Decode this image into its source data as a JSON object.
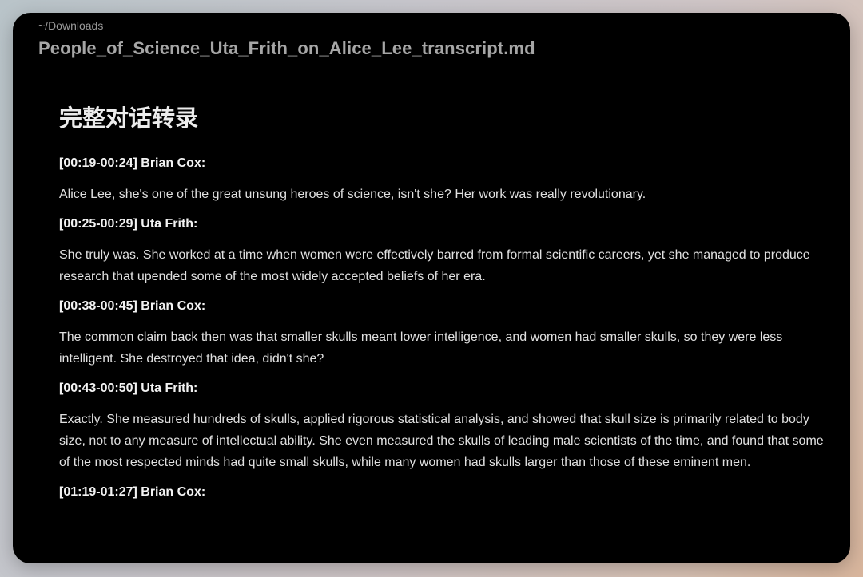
{
  "window": {
    "path": "~/Downloads",
    "filename": "People_of_Science_Uta_Frith_on_Alice_Lee_transcript.md"
  },
  "document": {
    "heading": "完整对话转录",
    "entries": [
      {
        "speaker": "[00:19-00:24] Brian Cox:",
        "text": "Alice Lee, she's one of the great unsung heroes of science, isn't she? Her work was really revolutionary."
      },
      {
        "speaker": "[00:25-00:29] Uta Frith:",
        "text": "She truly was. She worked at a time when women were effectively barred from formal scientific careers, yet she managed to produce research that upended some of the most widely accepted beliefs of her era."
      },
      {
        "speaker": "[00:38-00:45] Brian Cox:",
        "text": "The common claim back then was that smaller skulls meant lower intelligence, and women had smaller skulls, so they were less intelligent. She destroyed that idea, didn't she?"
      },
      {
        "speaker": "[00:43-00:50] Uta Frith:",
        "text": "Exactly. She measured hundreds of skulls, applied rigorous statistical analysis, and showed that skull size is primarily related to body size, not to any measure of intellectual ability. She even measured the skulls of leading male scientists of the time, and found that some of the most respected minds had quite small skulls, while many women had skulls larger than those of these eminent men."
      },
      {
        "speaker": "[01:19-01:27] Brian Cox:",
        "text": ""
      }
    ]
  }
}
